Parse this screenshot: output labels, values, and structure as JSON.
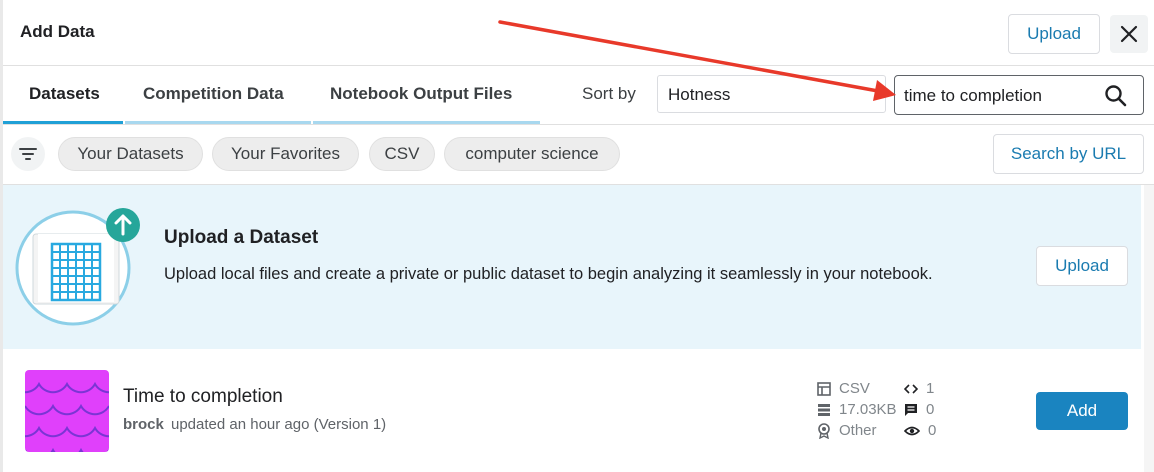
{
  "header": {
    "title": "Add Data",
    "upload_label": "Upload"
  },
  "tabs": [
    {
      "label": "Datasets",
      "active": true
    },
    {
      "label": "Competition Data",
      "active": false
    },
    {
      "label": "Notebook Output Files",
      "active": false
    }
  ],
  "sort": {
    "label": "Sort by",
    "value": "Hotness"
  },
  "search": {
    "value": "time to completion",
    "icon": "search-icon"
  },
  "chips": [
    "Your Datasets",
    "Your Favorites",
    "CSV",
    "computer science"
  ],
  "search_by_url_label": "Search by URL",
  "banner": {
    "title": "Upload a Dataset",
    "description": "Upload local files and create a private or public dataset to begin analyzing it seamlessly in your notebook.",
    "button_label": "Upload"
  },
  "dataset": {
    "title": "Time to completion",
    "owner": "brock",
    "updated": "updated an hour ago (Version 1)",
    "file_type": "CSV",
    "size": "17.03KB",
    "license": "Other",
    "code_count": "1",
    "comments_count": "0",
    "views_count": "0",
    "add_label": "Add"
  },
  "colors": {
    "accent": "#20a0d6",
    "add_button": "#1a84c0",
    "banner_bg": "#e8f5fb",
    "annotation_arrow": "#e8392a",
    "thumbnail": "#e040fb"
  }
}
